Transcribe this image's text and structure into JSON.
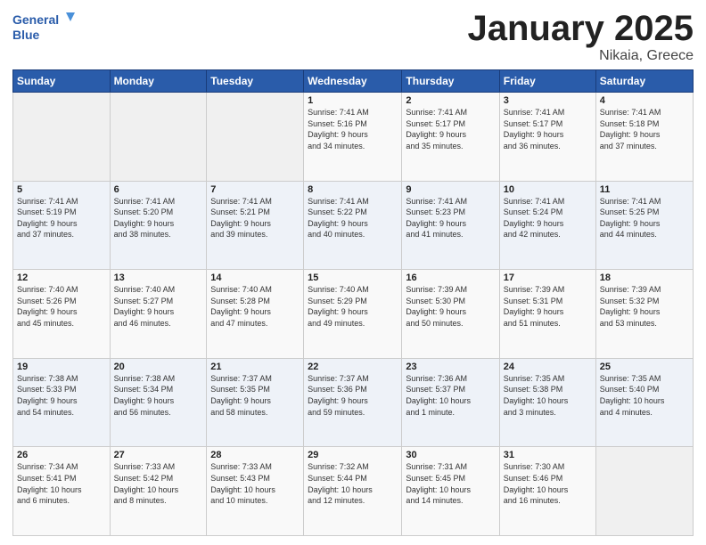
{
  "logo": {
    "line1": "General",
    "line2": "Blue"
  },
  "title": "January 2025",
  "subtitle": "Nikaia, Greece",
  "days_header": [
    "Sunday",
    "Monday",
    "Tuesday",
    "Wednesday",
    "Thursday",
    "Friday",
    "Saturday"
  ],
  "weeks": [
    [
      {
        "num": "",
        "info": ""
      },
      {
        "num": "",
        "info": ""
      },
      {
        "num": "",
        "info": ""
      },
      {
        "num": "1",
        "info": "Sunrise: 7:41 AM\nSunset: 5:16 PM\nDaylight: 9 hours\nand 34 minutes."
      },
      {
        "num": "2",
        "info": "Sunrise: 7:41 AM\nSunset: 5:17 PM\nDaylight: 9 hours\nand 35 minutes."
      },
      {
        "num": "3",
        "info": "Sunrise: 7:41 AM\nSunset: 5:17 PM\nDaylight: 9 hours\nand 36 minutes."
      },
      {
        "num": "4",
        "info": "Sunrise: 7:41 AM\nSunset: 5:18 PM\nDaylight: 9 hours\nand 37 minutes."
      }
    ],
    [
      {
        "num": "5",
        "info": "Sunrise: 7:41 AM\nSunset: 5:19 PM\nDaylight: 9 hours\nand 37 minutes."
      },
      {
        "num": "6",
        "info": "Sunrise: 7:41 AM\nSunset: 5:20 PM\nDaylight: 9 hours\nand 38 minutes."
      },
      {
        "num": "7",
        "info": "Sunrise: 7:41 AM\nSunset: 5:21 PM\nDaylight: 9 hours\nand 39 minutes."
      },
      {
        "num": "8",
        "info": "Sunrise: 7:41 AM\nSunset: 5:22 PM\nDaylight: 9 hours\nand 40 minutes."
      },
      {
        "num": "9",
        "info": "Sunrise: 7:41 AM\nSunset: 5:23 PM\nDaylight: 9 hours\nand 41 minutes."
      },
      {
        "num": "10",
        "info": "Sunrise: 7:41 AM\nSunset: 5:24 PM\nDaylight: 9 hours\nand 42 minutes."
      },
      {
        "num": "11",
        "info": "Sunrise: 7:41 AM\nSunset: 5:25 PM\nDaylight: 9 hours\nand 44 minutes."
      }
    ],
    [
      {
        "num": "12",
        "info": "Sunrise: 7:40 AM\nSunset: 5:26 PM\nDaylight: 9 hours\nand 45 minutes."
      },
      {
        "num": "13",
        "info": "Sunrise: 7:40 AM\nSunset: 5:27 PM\nDaylight: 9 hours\nand 46 minutes."
      },
      {
        "num": "14",
        "info": "Sunrise: 7:40 AM\nSunset: 5:28 PM\nDaylight: 9 hours\nand 47 minutes."
      },
      {
        "num": "15",
        "info": "Sunrise: 7:40 AM\nSunset: 5:29 PM\nDaylight: 9 hours\nand 49 minutes."
      },
      {
        "num": "16",
        "info": "Sunrise: 7:39 AM\nSunset: 5:30 PM\nDaylight: 9 hours\nand 50 minutes."
      },
      {
        "num": "17",
        "info": "Sunrise: 7:39 AM\nSunset: 5:31 PM\nDaylight: 9 hours\nand 51 minutes."
      },
      {
        "num": "18",
        "info": "Sunrise: 7:39 AM\nSunset: 5:32 PM\nDaylight: 9 hours\nand 53 minutes."
      }
    ],
    [
      {
        "num": "19",
        "info": "Sunrise: 7:38 AM\nSunset: 5:33 PM\nDaylight: 9 hours\nand 54 minutes."
      },
      {
        "num": "20",
        "info": "Sunrise: 7:38 AM\nSunset: 5:34 PM\nDaylight: 9 hours\nand 56 minutes."
      },
      {
        "num": "21",
        "info": "Sunrise: 7:37 AM\nSunset: 5:35 PM\nDaylight: 9 hours\nand 58 minutes."
      },
      {
        "num": "22",
        "info": "Sunrise: 7:37 AM\nSunset: 5:36 PM\nDaylight: 9 hours\nand 59 minutes."
      },
      {
        "num": "23",
        "info": "Sunrise: 7:36 AM\nSunset: 5:37 PM\nDaylight: 10 hours\nand 1 minute."
      },
      {
        "num": "24",
        "info": "Sunrise: 7:35 AM\nSunset: 5:38 PM\nDaylight: 10 hours\nand 3 minutes."
      },
      {
        "num": "25",
        "info": "Sunrise: 7:35 AM\nSunset: 5:40 PM\nDaylight: 10 hours\nand 4 minutes."
      }
    ],
    [
      {
        "num": "26",
        "info": "Sunrise: 7:34 AM\nSunset: 5:41 PM\nDaylight: 10 hours\nand 6 minutes."
      },
      {
        "num": "27",
        "info": "Sunrise: 7:33 AM\nSunset: 5:42 PM\nDaylight: 10 hours\nand 8 minutes."
      },
      {
        "num": "28",
        "info": "Sunrise: 7:33 AM\nSunset: 5:43 PM\nDaylight: 10 hours\nand 10 minutes."
      },
      {
        "num": "29",
        "info": "Sunrise: 7:32 AM\nSunset: 5:44 PM\nDaylight: 10 hours\nand 12 minutes."
      },
      {
        "num": "30",
        "info": "Sunrise: 7:31 AM\nSunset: 5:45 PM\nDaylight: 10 hours\nand 14 minutes."
      },
      {
        "num": "31",
        "info": "Sunrise: 7:30 AM\nSunset: 5:46 PM\nDaylight: 10 hours\nand 16 minutes."
      },
      {
        "num": "",
        "info": ""
      }
    ]
  ]
}
